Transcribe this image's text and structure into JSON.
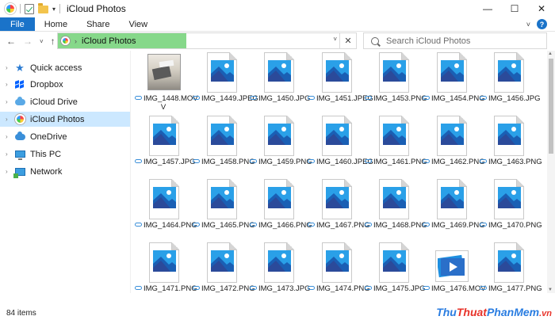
{
  "window": {
    "title": "iCloud Photos",
    "minimize": "—",
    "maximize": "☐",
    "close": "✕"
  },
  "ribbon": {
    "tabs": [
      "File",
      "Home",
      "Share",
      "View"
    ]
  },
  "address": {
    "breadcrumb": "iCloud Photos",
    "refresh": "✕"
  },
  "search": {
    "placeholder": "Search iCloud Photos"
  },
  "nav_pane": {
    "items": [
      {
        "label": "Quick access",
        "icon": "star-icon"
      },
      {
        "label": "Dropbox",
        "icon": "dropbox-icon"
      },
      {
        "label": "iCloud Drive",
        "icon": "cloud-icon"
      },
      {
        "label": "iCloud Photos",
        "icon": "icloud-photos-icon",
        "selected": true
      },
      {
        "label": "OneDrive",
        "icon": "onedrive-icon"
      },
      {
        "label": "This PC",
        "icon": "computer-icon"
      },
      {
        "label": "Network",
        "icon": "network-icon"
      }
    ]
  },
  "files": [
    {
      "name": "IMG_1448.MOV",
      "line2": "V",
      "kind": "photo"
    },
    {
      "name": "IMG_1449.JPEG",
      "kind": "image"
    },
    {
      "name": "IMG_1450.JPG",
      "kind": "image"
    },
    {
      "name": "IMG_1451.JPEG",
      "kind": "image"
    },
    {
      "name": "IMG_1453.PNG",
      "kind": "image"
    },
    {
      "name": "IMG_1454.PNG",
      "kind": "image"
    },
    {
      "name": "IMG_1456.JPG",
      "kind": "image"
    },
    {
      "name": "IMG_1457.JPG",
      "kind": "image"
    },
    {
      "name": "IMG_1458.PNG",
      "kind": "image"
    },
    {
      "name": "IMG_1459.PNG",
      "kind": "image"
    },
    {
      "name": "IMG_1460.JPEG",
      "kind": "image"
    },
    {
      "name": "IMG_1461.PNG",
      "kind": "image"
    },
    {
      "name": "IMG_1462.PNG",
      "kind": "image"
    },
    {
      "name": "IMG_1463.PNG",
      "kind": "image"
    },
    {
      "name": "IMG_1464.PNG",
      "kind": "image"
    },
    {
      "name": "IMG_1465.PNG",
      "kind": "image"
    },
    {
      "name": "IMG_1466.PNG",
      "kind": "image"
    },
    {
      "name": "IMG_1467.PNG",
      "kind": "image"
    },
    {
      "name": "IMG_1468.PNG",
      "kind": "image"
    },
    {
      "name": "IMG_1469.PNG",
      "kind": "image"
    },
    {
      "name": "IMG_1470.PNG",
      "kind": "image"
    },
    {
      "name": "IMG_1471.PNG",
      "kind": "image"
    },
    {
      "name": "IMG_1472.PNG",
      "kind": "image"
    },
    {
      "name": "IMG_1473.JPG",
      "kind": "image"
    },
    {
      "name": "IMG_1474.PNG",
      "kind": "image"
    },
    {
      "name": "IMG_1475.JPG",
      "kind": "image"
    },
    {
      "name": "IMG_1476.MOV",
      "line2": "V",
      "kind": "video"
    },
    {
      "name": "IMG_1477.PNG",
      "kind": "image"
    }
  ],
  "status": {
    "count": "84 items"
  },
  "watermark": {
    "part1": "Thu",
    "part2": "Thuat",
    "part3": "PhanMem",
    "part4": ".vn"
  },
  "colors": {
    "accent": "#1a73c9",
    "address_highlight": "#86d88a",
    "selection": "#cce8ff"
  }
}
